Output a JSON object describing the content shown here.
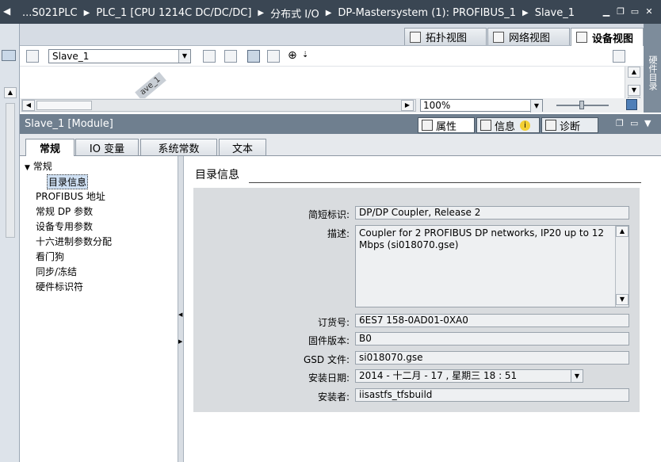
{
  "titlebar": {
    "breadcrumb": [
      "...S021PLC",
      "PLC_1 [CPU 1214C DC/DC/DC]",
      "分布式 I/O",
      "DP-Mastersystem (1): PROFIBUS_1",
      "Slave_1"
    ],
    "window_buttons": [
      "minimize",
      "restore",
      "maximize",
      "close"
    ]
  },
  "view_tabs": [
    {
      "label": "拓扑视图",
      "icon": "topology-icon"
    },
    {
      "label": "网络视图",
      "icon": "network-icon"
    },
    {
      "label": "设备视图",
      "icon": "device-icon",
      "active": true
    }
  ],
  "toolbar": {
    "device_select": "Slave_1",
    "zoom": "100%"
  },
  "right_tab": {
    "label": "硬件目录"
  },
  "canvas": {
    "slave_tag": "ave_1"
  },
  "module": {
    "title": "Slave_1 [Module]",
    "tabs": [
      {
        "label": "属性",
        "active": true,
        "icon": "properties-icon"
      },
      {
        "label": "信息",
        "icon": "info-icon"
      },
      {
        "label": "诊断",
        "icon": "diagnostics-icon"
      }
    ]
  },
  "sub_tabs": [
    {
      "label": "常规",
      "active": true
    },
    {
      "label": "IO 变量"
    },
    {
      "label": "系统常数"
    },
    {
      "label": "文本"
    }
  ],
  "nav": {
    "root": "常规",
    "selected": "目录信息",
    "items": [
      "PROFIBUS 地址",
      "常规 DP 参数",
      "设备专用参数",
      "十六进制参数分配",
      "看门狗",
      "同步/冻结",
      "硬件标识符"
    ]
  },
  "section": {
    "title": "目录信息"
  },
  "form": {
    "short_id_label": "简短标识:",
    "short_id": "DP/DP Coupler, Release 2",
    "desc_label": "描述:",
    "desc": "Coupler for 2 PROFIBUS DP networks, IP20 up to 12 Mbps (si018070.gse)",
    "order_label": "订货号:",
    "order": "6ES7 158-0AD01-0XA0",
    "firmware_label": "固件版本:",
    "firmware": "B0",
    "gsd_label": "GSD 文件:",
    "gsd": "si018070.gse",
    "install_date_label": "安装日期:",
    "install_date": "2014 - 十二月  - 17 , 星期三    18 : 51",
    "installer_label": "安装者:",
    "installer": "iisastfs_tfsbuild"
  }
}
